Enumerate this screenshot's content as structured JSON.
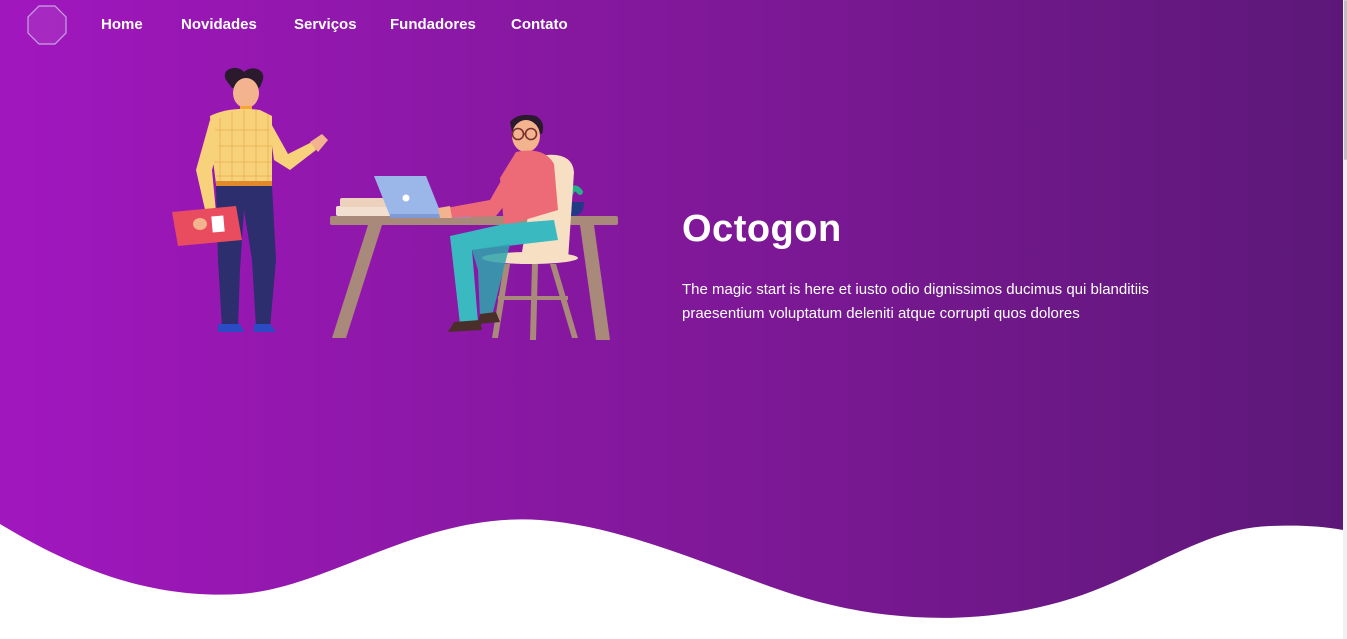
{
  "brand": {
    "logo_icon": "octagon-logo-icon"
  },
  "nav": {
    "items": [
      {
        "label": "Home"
      },
      {
        "label": "Novidades"
      },
      {
        "label": "Serviços"
      },
      {
        "label": "Fundadores"
      },
      {
        "label": "Contato"
      }
    ]
  },
  "hero": {
    "title": "Octogon",
    "description": "The magic start is here et iusto odio dignissimos ducimus qui blanditiis praesentium voluptatum deleniti atque corrupti quos dolores",
    "illustration": "office-workers-illustration"
  },
  "colors": {
    "gradient_start": "#a117be",
    "gradient_end": "#5c1878",
    "text": "#ffffff",
    "wave": "#ffffff"
  }
}
